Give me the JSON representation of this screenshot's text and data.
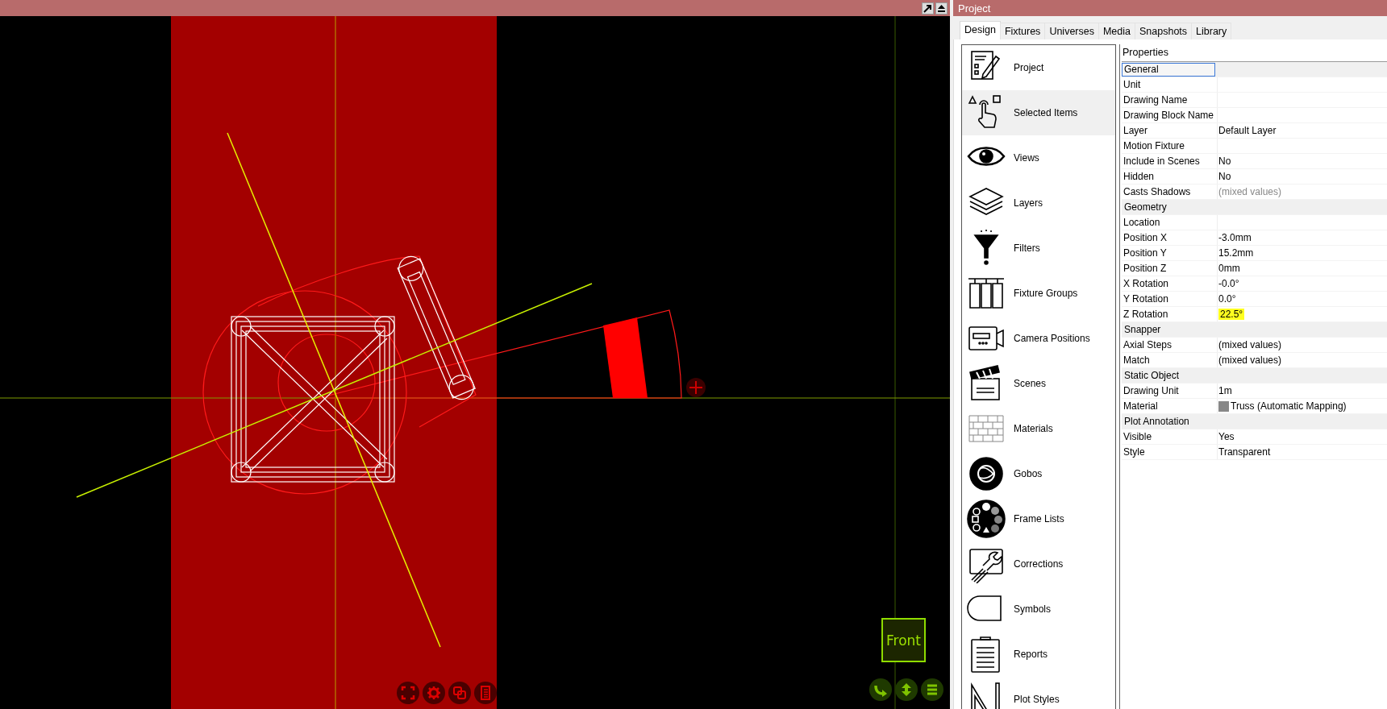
{
  "viewport": {
    "view_button": "Front"
  },
  "panel": {
    "title": "Project",
    "tabs": [
      {
        "label": "Design",
        "selected": true
      },
      {
        "label": "Fixtures",
        "selected": false
      },
      {
        "label": "Universes",
        "selected": false
      },
      {
        "label": "Media",
        "selected": false
      },
      {
        "label": "Snapshots",
        "selected": false
      },
      {
        "label": "Library",
        "selected": false
      }
    ],
    "sidebar": {
      "items": [
        {
          "label": "Project",
          "selected": false
        },
        {
          "label": "Selected Items",
          "selected": true
        },
        {
          "label": "Views",
          "selected": false
        },
        {
          "label": "Layers",
          "selected": false
        },
        {
          "label": "Filters",
          "selected": false
        },
        {
          "label": "Fixture Groups",
          "selected": false
        },
        {
          "label": "Camera Positions",
          "selected": false
        },
        {
          "label": "Scenes",
          "selected": false
        },
        {
          "label": "Materials",
          "selected": false
        },
        {
          "label": "Gobos",
          "selected": false
        },
        {
          "label": "Frame Lists",
          "selected": false
        },
        {
          "label": "Corrections",
          "selected": false
        },
        {
          "label": "Symbols",
          "selected": false
        },
        {
          "label": "Reports",
          "selected": false
        },
        {
          "label": "Plot Styles",
          "selected": false
        }
      ]
    },
    "properties": {
      "heading": "Properties",
      "rows": [
        {
          "kind": "category",
          "name": "General",
          "focused": true
        },
        {
          "kind": "property",
          "name": "Unit"
        },
        {
          "kind": "property",
          "name": "Drawing Name"
        },
        {
          "kind": "property",
          "name": "Drawing Block Name"
        },
        {
          "kind": "property",
          "name": "Layer",
          "value": "Default Layer"
        },
        {
          "kind": "property",
          "name": "Motion Fixture"
        },
        {
          "kind": "property",
          "name": "Include in Scenes",
          "value": "No"
        },
        {
          "kind": "property",
          "name": "Hidden",
          "value": "No"
        },
        {
          "kind": "property",
          "name": "Casts Shadows",
          "value": "(mixed values)",
          "greyed": true
        },
        {
          "kind": "category",
          "name": "Geometry",
          "focused": false
        },
        {
          "kind": "property",
          "name": "Location"
        },
        {
          "kind": "property",
          "name": "Position X",
          "value": "-3.0mm"
        },
        {
          "kind": "property",
          "name": "Position Y",
          "value": "15.2mm"
        },
        {
          "kind": "property",
          "name": "Position Z",
          "value": "0mm"
        },
        {
          "kind": "property",
          "name": "X Rotation",
          "value": "-0.0°"
        },
        {
          "kind": "property",
          "name": "Y Rotation",
          "value": "0.0°"
        },
        {
          "kind": "property",
          "name": "Z Rotation",
          "value": "22.5°",
          "highlighted": true
        },
        {
          "kind": "category",
          "name": "Snapper",
          "focused": false
        },
        {
          "kind": "property",
          "name": "Axial Steps",
          "value": "(mixed values)"
        },
        {
          "kind": "property",
          "name": "Match",
          "value": "(mixed values)"
        },
        {
          "kind": "category",
          "name": "Static Object",
          "focused": false
        },
        {
          "kind": "property",
          "name": "Drawing Unit",
          "value": "1m"
        },
        {
          "kind": "material",
          "name": "Material",
          "value": "Truss (Automatic Mapping)"
        },
        {
          "kind": "category",
          "name": "Plot Annotation",
          "focused": false
        },
        {
          "kind": "property",
          "name": "Visible",
          "value": "Yes"
        },
        {
          "kind": "property",
          "name": "Style",
          "value": "Transparent"
        }
      ]
    }
  }
}
